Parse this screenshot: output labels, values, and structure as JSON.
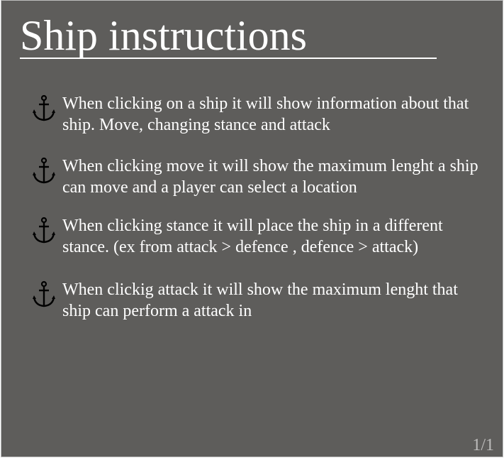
{
  "slide": {
    "title": "Ship instructions",
    "items": [
      {
        "icon": "anchor-icon",
        "text": "When clicking on a ship it will show information about that ship. Move, changing stance and attack"
      },
      {
        "icon": "anchor-icon",
        "text": "When clicking move it will show the maximum lenght a ship can move and a player can select a location"
      },
      {
        "icon": "anchor-icon",
        "text": "When clicking stance it will place the ship in a different stance. (ex from attack > defence , defence > attack)"
      },
      {
        "icon": "anchor-icon",
        "text": "When clickig attack it will show the maximum lenght that ship can perform a attack in"
      }
    ],
    "page_number": "1/1"
  },
  "colors": {
    "background": "#5e5d5b",
    "text": "#ffffff",
    "icon": "#000000",
    "page_number": "#bdbcbb"
  }
}
